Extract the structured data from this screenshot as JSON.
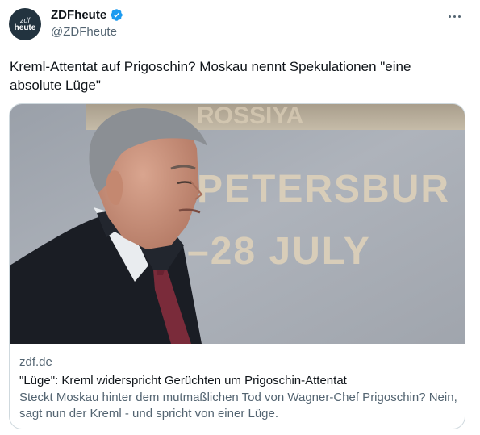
{
  "author": {
    "avatar_text_line1": "zdf",
    "avatar_text_line2": "heute",
    "display_name": "ZDFheute",
    "handle": "@ZDFheute"
  },
  "tweet": {
    "text": "Kreml-Attentat auf Prigoschin? Moskau nennt Spekulationen \"eine absolute Lüge\""
  },
  "card": {
    "image_text_line1": "PETERSBUR",
    "image_text_line2": "–28 JULY",
    "domain": "zdf.de",
    "title": "\"Lüge\": Kreml widerspricht Gerüchten um Prigoschin-Attentat",
    "description": "Steckt Moskau hinter dem mutmaßlichen Tod von Wagner-Chef Prigoschin? Nein, sagt nun der Kreml - und spricht von einer Lüge."
  },
  "colors": {
    "verified_blue": "#1d9bf0",
    "secondary_text": "#536471",
    "border": "#cfd9de"
  }
}
